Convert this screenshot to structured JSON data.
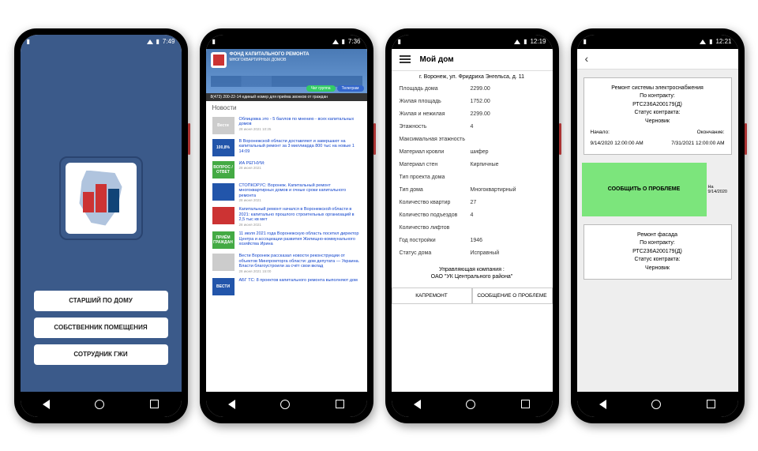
{
  "screen1": {
    "status": {
      "time": "7:49"
    },
    "buttons": {
      "senior": "СТАРШИЙ ПО ДОМУ",
      "owner": "СОБСТВЕННИК ПОМЕЩЕНИЯ",
      "inspector": "СОТРУДНИК ГЖИ"
    }
  },
  "screen2": {
    "status": {
      "time": "7:36"
    },
    "banner": {
      "title": "ФОНД КАПИТАЛЬНОГО РЕМОНТА",
      "subtitle": "МНОГОКВАРТИРНЫХ ДОМОВ",
      "pill_green": "Чат группа",
      "pill_blue": "Телеграм"
    },
    "ticker": "8(473) 200-22-14 единый номер для приёма звонков от граждан",
    "news_heading": "Новости",
    "news": [
      {
        "title": "Облицовка это - 5 баллов по мнению - всех капитальных домов",
        "date": "28 июня 2021 10:25",
        "thumb": "Вести"
      },
      {
        "title": "В Воронежской области доставляют и завершают на капитальный ремонт за 3 миллиарда 800 тыс на новые 1 14:09",
        "date": "",
        "thumb": "100,8%"
      },
      {
        "title": "ИА РЕГНУМ:",
        "date": "28 июня 2021",
        "thumb": "ВОПРОС / ОТВЕТ"
      },
      {
        "title": "СТОПКОРУС: Воронеж. Капитальный ремонт многоквартирных домов и очные сроки капитального ремонта",
        "date": "28 июня 2021",
        "thumb": ""
      },
      {
        "title": "Капитальный ремонт начался в Воронежской области в 2021: капитально прошлого строительных организаций в 2,5 тыс кв мет",
        "date": "28 июня 2021",
        "thumb": ""
      },
      {
        "title": "11 июля 2021 года Воронежскую область посетил директор Центра и ассоциации развития Жилищно-коммунального хозяйства Ирина",
        "date": "",
        "thumb": "ПРИЁМ ГРАЖДАН"
      },
      {
        "title": "Вести Воронеж рассказал новости реконструкции от объектов Минпромторга области: дом депутата — Украина. Власти благоустроили за счёт свои вклад",
        "date": "28 июня 2021 15:00",
        "thumb": ""
      },
      {
        "title": "АБГ ТС: 8 проектов капитального ремонта выполняют дом",
        "date": "",
        "thumb": "ВЕСТИ"
      }
    ]
  },
  "screen3": {
    "status": {
      "time": "12:19"
    },
    "title": "Мой дом",
    "address": "г. Воронеж, ул. Фридриха Энгельса, д. 11",
    "props": [
      {
        "k": "Площадь дома",
        "v": "2299.00"
      },
      {
        "k": "Жилая площадь",
        "v": "1752.00"
      },
      {
        "k": "Жилая и нежилая",
        "v": "2299.00"
      },
      {
        "k": "Этажность",
        "v": "4"
      },
      {
        "k": "Максимальная этажность",
        "v": ""
      },
      {
        "k": "Материал кровли",
        "v": "шифер"
      },
      {
        "k": "Материал стен",
        "v": "Кирпичные"
      },
      {
        "k": "Тип проекта дома",
        "v": ""
      },
      {
        "k": "Тип дома",
        "v": "Многоквартирный"
      },
      {
        "k": "Количество квартир",
        "v": "27"
      },
      {
        "k": "Количество подъездов",
        "v": "4"
      },
      {
        "k": "Количество лифтов",
        "v": ""
      },
      {
        "k": "Год постройки",
        "v": "1946"
      },
      {
        "k": "Статус дома",
        "v": "Исправный"
      }
    ],
    "mgmt_label": "Управляющая компания :",
    "mgmt_value": "ОАО \"УК Центрального района\"",
    "tabs": {
      "left": "КАПРЕМОНТ",
      "right": "СООБЩЕНИЕ О ПРОБЛЕМЕ"
    }
  },
  "screen4": {
    "status": {
      "time": "12:21"
    },
    "card1": {
      "title": "Ремонт системы электроснабжения",
      "contract_label": "По контракту:",
      "contract": "РТС236А200179(Д)",
      "status_label": "Статус контракта:",
      "status": "Черновик",
      "start_label": "Начало:",
      "start": "9/14/2020 12:00:00 AM",
      "end_label": "Окончание:",
      "end": "7/31/2021 12:00:00 AM"
    },
    "report_button": "СООБЩИТЬ О ПРОБЛЕМЕ",
    "report_side": {
      "l1": "На",
      "l2": "9/14/2020"
    },
    "card2": {
      "title": "Ремонт фасада",
      "contract_label": "По контракту:",
      "contract": "РТС236А200179(Д)",
      "status_label": "Статус контракта:",
      "status": "Черновик"
    }
  }
}
